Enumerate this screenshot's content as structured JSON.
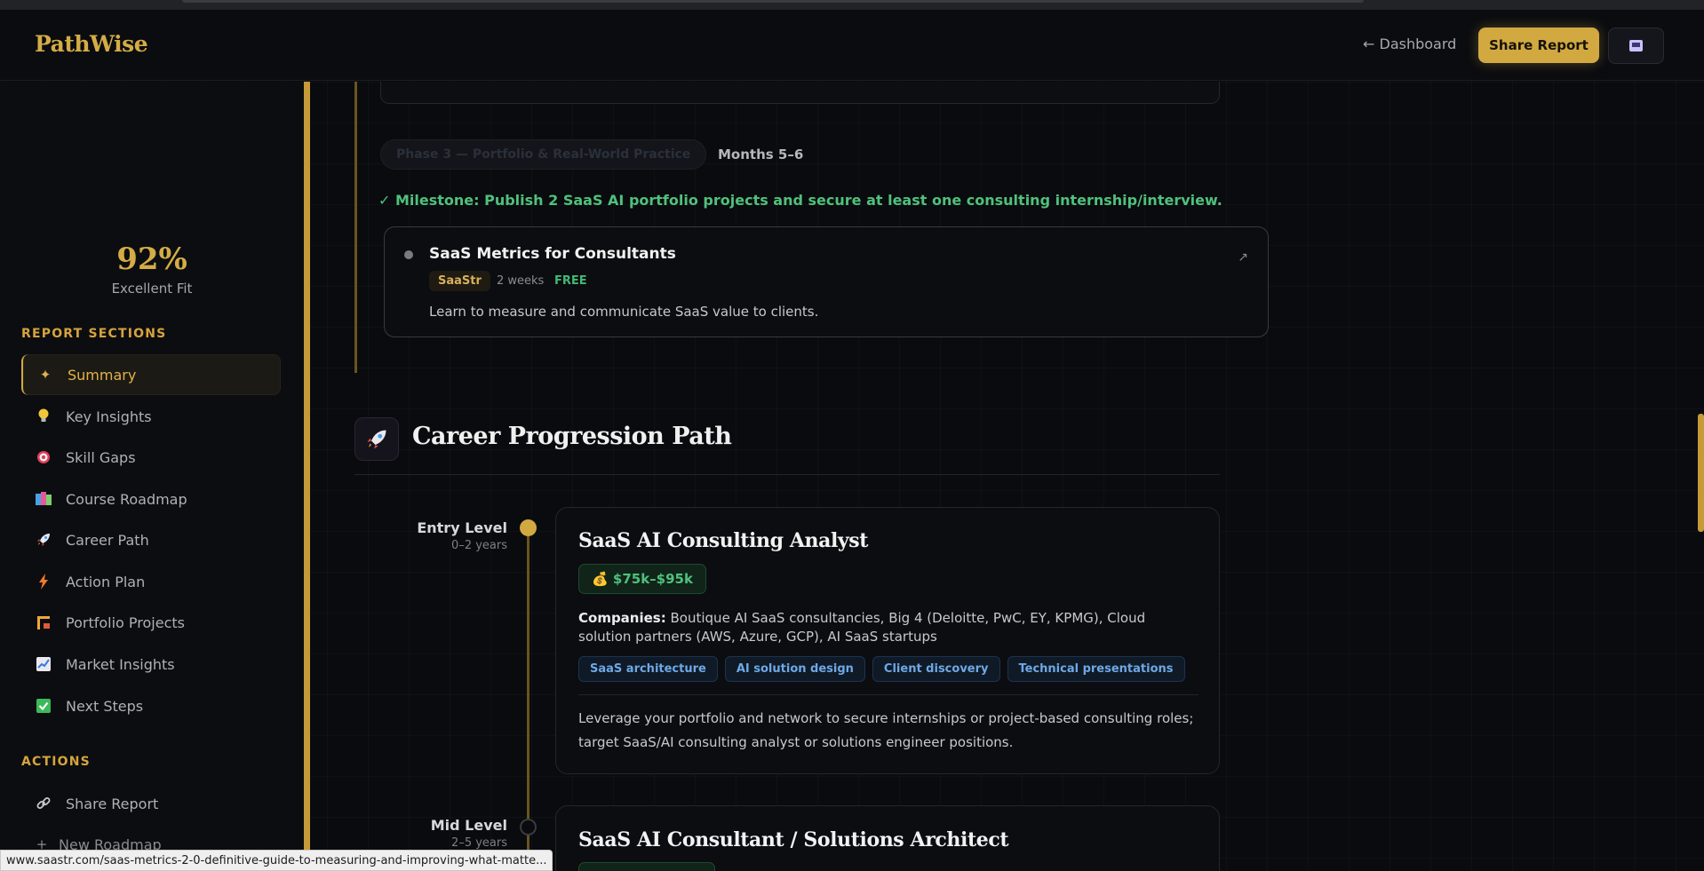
{
  "header": {
    "logo": "PathWise",
    "dashboard_link": "← Dashboard",
    "share_button": "Share Report",
    "print_icon": "printer-icon"
  },
  "sidebar": {
    "score_value": "92%",
    "score_label": "Excellent Fit",
    "report_sections_heading": "REPORT SECTIONS",
    "items": [
      {
        "label": "Summary",
        "icon": "sparkle-icon",
        "active": true
      },
      {
        "label": "Key Insights",
        "icon": "lightbulb-icon"
      },
      {
        "label": "Skill Gaps",
        "icon": "target-icon"
      },
      {
        "label": "Course Roadmap",
        "icon": "books-icon"
      },
      {
        "label": "Career Path",
        "icon": "rocket-icon"
      },
      {
        "label": "Action Plan",
        "icon": "lightning-icon"
      },
      {
        "label": "Portfolio Projects",
        "icon": "crane-icon"
      },
      {
        "label": "Market Insights",
        "icon": "chart-icon"
      },
      {
        "label": "Next Steps",
        "icon": "checkbox-icon"
      }
    ],
    "actions_heading": "ACTIONS",
    "actions": [
      {
        "label": "Share Report",
        "icon": "link-icon"
      },
      {
        "label": "New Roadmap",
        "icon": "plus-icon"
      }
    ]
  },
  "roadmap": {
    "phase_label": "Phase 3 — Portfolio & Real-World Practice",
    "phase_months": "Months 5–6",
    "milestone": "✓ Milestone: Publish 2 SaaS AI portfolio projects and secure at least one consulting internship/interview.",
    "course": {
      "title": "SaaS Metrics for Consultants",
      "provider": "SaaStr",
      "duration": "2 weeks",
      "price": "FREE",
      "description": "Learn to measure and communicate SaaS value to clients.",
      "external_icon": "↗"
    }
  },
  "career_path": {
    "section_icon": "rocket-icon",
    "title": "Career Progression Path",
    "levels": [
      {
        "level": "Entry Level",
        "years": "0–2 years",
        "role": "SaaS AI Consulting Analyst",
        "salary": "💰 $75k–$95k",
        "companies_label": "Companies:",
        "companies": "Boutique AI SaaS consultancies, Big 4 (Deloitte, PwC, EY, KPMG), Cloud solution partners (AWS, Azure, GCP), AI SaaS startups",
        "skills": [
          "SaaS architecture",
          "AI solution design",
          "Client discovery",
          "Technical presentations"
        ],
        "description": "Leverage your portfolio and network to secure internships or project-based consulting roles; target SaaS/AI consulting analyst or solutions engineer positions."
      },
      {
        "level": "Mid Level",
        "years": "2–5 years",
        "role": "SaaS AI Consultant / Solutions Architect"
      }
    ]
  },
  "status_bar": {
    "url": "www.saastr.com/saas-metrics-2-0-definitive-guide-to-measuring-and-improving-what-matte..."
  },
  "colors": {
    "accent_gold": "#d2a941",
    "success_green": "#4fc17c",
    "tag_blue": "#6ea8e6",
    "background": "#0a0b0e"
  }
}
